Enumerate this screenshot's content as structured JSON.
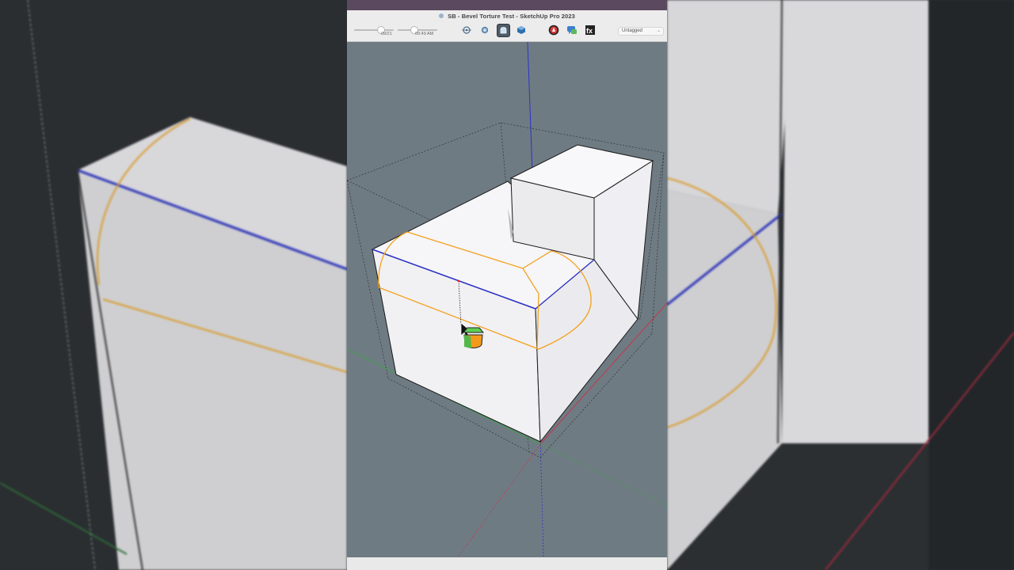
{
  "window": {
    "title": "SB - Bevel Torture Test - SketchUp Pro 2023"
  },
  "shadow_controls": {
    "date_label": "09/21",
    "time_label": "09:49 AM",
    "date_level": 0.68,
    "time_level": 0.38
  },
  "toolbar": {
    "buttons": [
      {
        "icon": "orbit-icon"
      },
      {
        "icon": "settings-gear-icon"
      },
      {
        "icon": "bevel-tool-icon",
        "active": true
      },
      {
        "icon": "cube-view-icon"
      },
      {
        "icon": "ruby-extension-icon"
      },
      {
        "icon": "chat-bubble-icon"
      },
      {
        "icon": "fx-extension-icon"
      }
    ],
    "tag_dropdown": {
      "selected": "Untagged"
    }
  },
  "viewport": {
    "background_color": "#6f7b83",
    "axis_colors": {
      "red": "#c2384f",
      "green": "#3ea24a",
      "blue": "#2b33c6"
    },
    "bevel_preview_color": "#f2a21c",
    "cursor_tool": "bevel-cursor-icon"
  }
}
